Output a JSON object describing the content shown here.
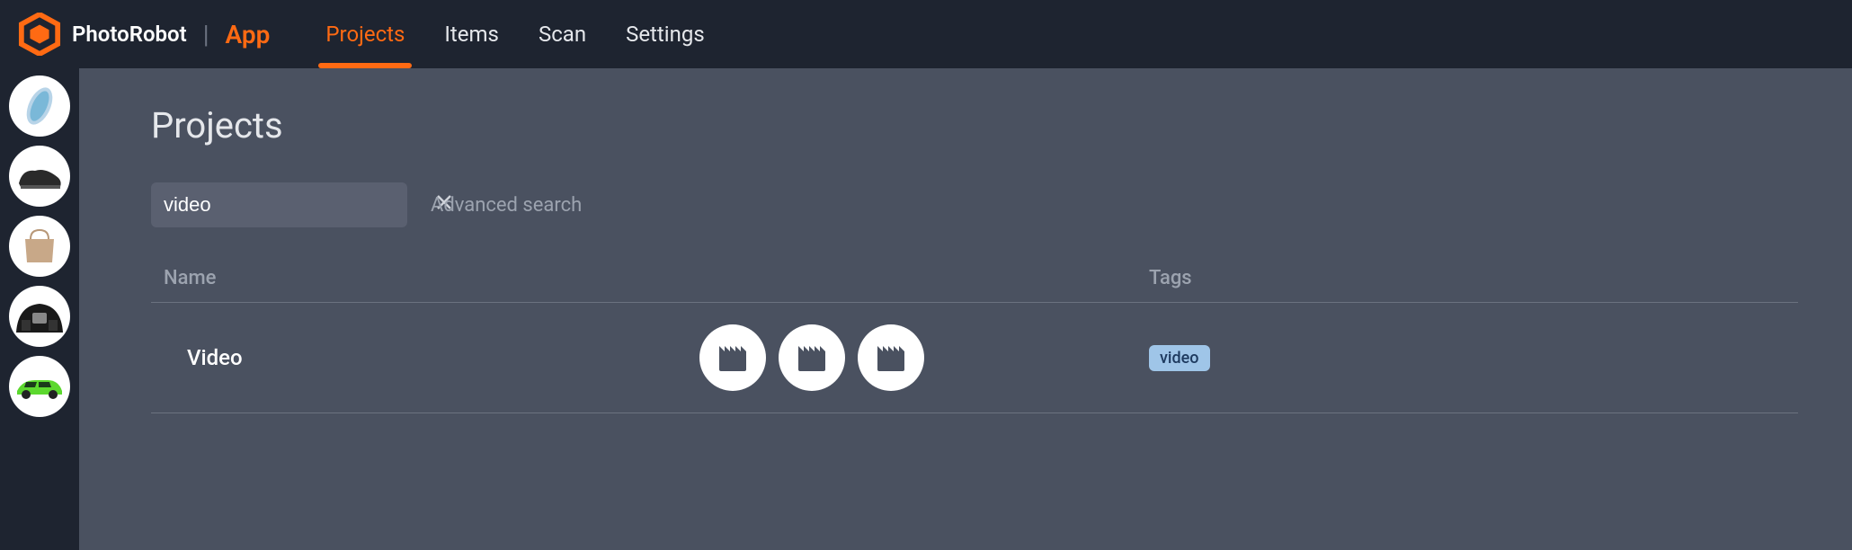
{
  "brand": {
    "name": "PhotoRobot",
    "app": "App"
  },
  "nav": {
    "projects": "Projects",
    "items": "Items",
    "scan": "Scan",
    "settings": "Settings"
  },
  "page": {
    "title": "Projects"
  },
  "search": {
    "value": "video",
    "advanced": "Advanced search"
  },
  "table": {
    "headers": {
      "name": "Name",
      "tags": "Tags"
    },
    "rows": [
      {
        "name": "Video",
        "tag": "video"
      }
    ]
  },
  "sidebar": {
    "items": [
      "shoe-sole",
      "sneaker",
      "handbag",
      "car-interior",
      "green-car"
    ]
  }
}
